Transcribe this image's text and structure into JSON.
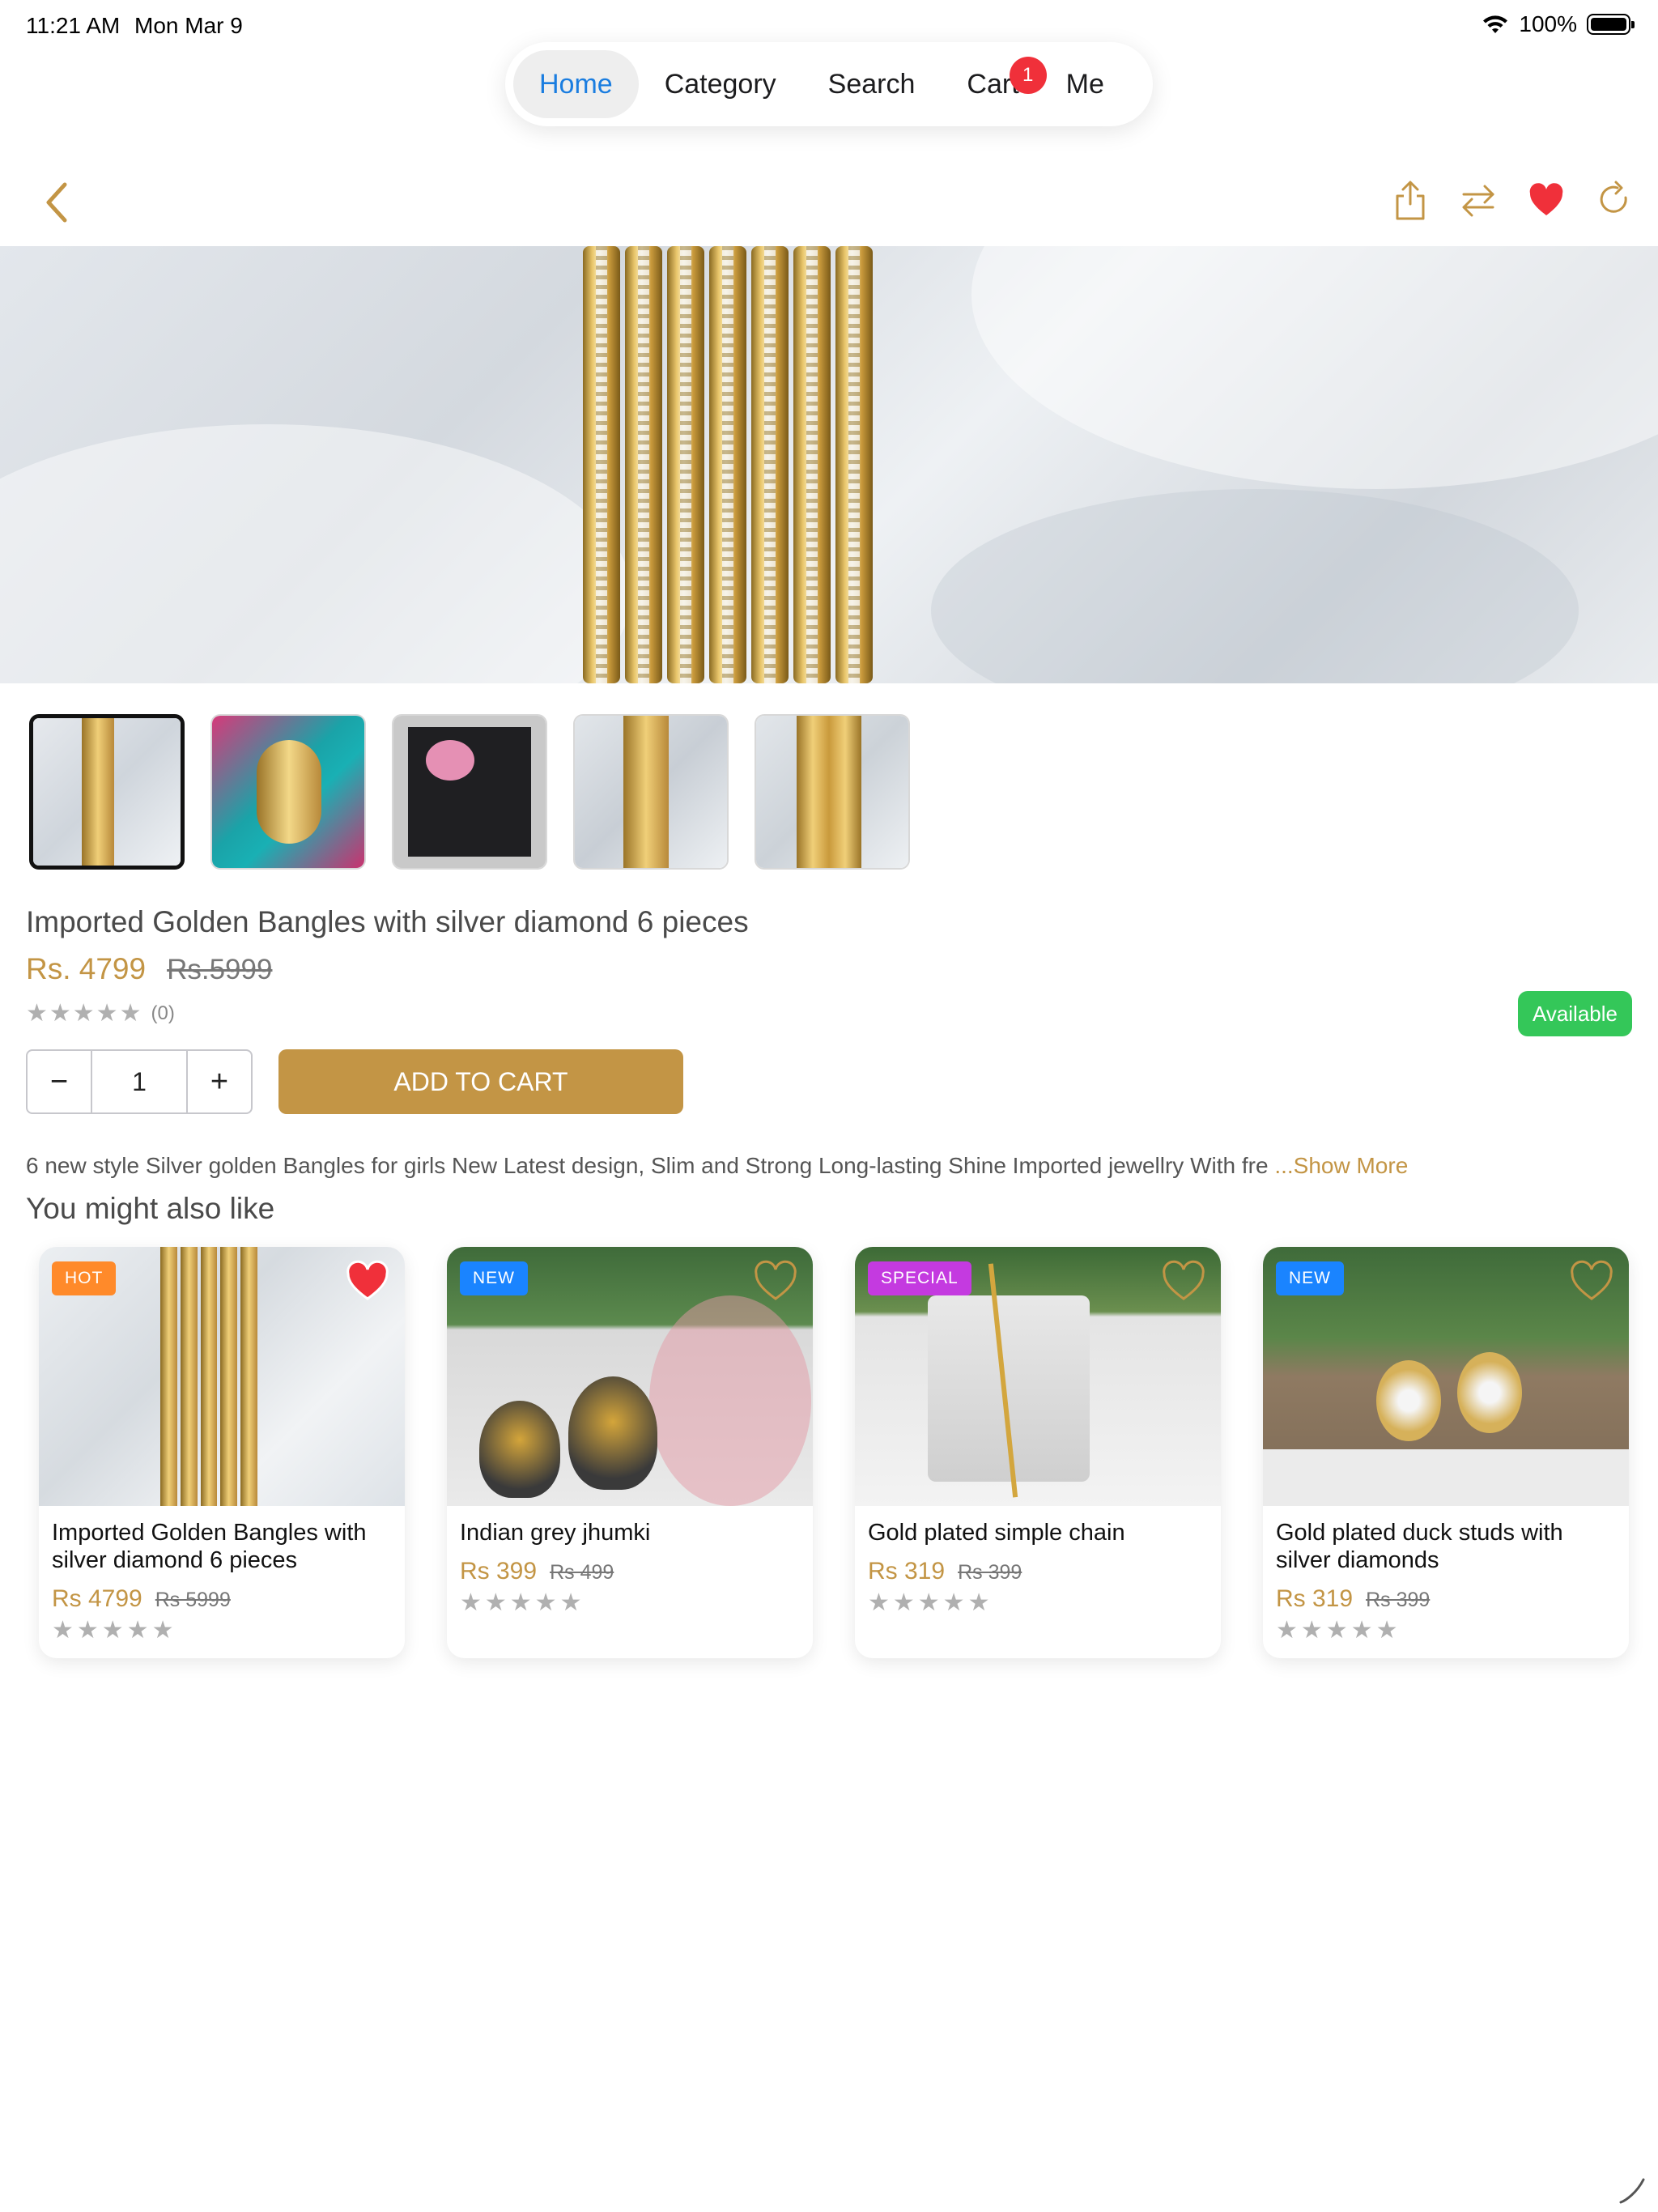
{
  "status_bar": {
    "time": "11:21 AM",
    "date": "Mon Mar 9",
    "battery": "100%"
  },
  "tabbar": {
    "tabs": [
      {
        "label": "Home",
        "active": true
      },
      {
        "label": "Category",
        "active": false
      },
      {
        "label": "Search",
        "active": false
      },
      {
        "label": "Cart",
        "active": false,
        "badge": "1"
      },
      {
        "label": "Me",
        "active": false
      }
    ]
  },
  "nav": {
    "icons": [
      "share-icon",
      "compare-icon",
      "heart-filled-icon",
      "refresh-icon"
    ]
  },
  "colors": {
    "accent": "#c39545",
    "available": "#34c759",
    "badge_hot": "#ff8a2a",
    "badge_new": "#1a84ff",
    "badge_special": "#c43ae0",
    "heart": "#f0303a",
    "active_tab": "#1a7de0"
  },
  "product": {
    "title": "Imported Golden Bangles with silver diamond 6 pieces",
    "price": "Rs. 4799",
    "old_price": "Rs.5999",
    "stars": "★★★★★",
    "rating_count": "(0)",
    "availability": "Available",
    "quantity": "1",
    "add_to_cart": "ADD TO CART",
    "description": "6 new style Silver golden Bangles for girls New Latest design, Slim and Strong Long-lasting Shine Imported jewellry With fre",
    "show_more": "...Show More"
  },
  "qty": {
    "minus": "−",
    "plus": "+"
  },
  "related": {
    "title": "You might also like",
    "items": [
      {
        "badge": "HOT",
        "title": "Imported Golden Bangles with silver diamond 6 pieces",
        "price": "Rs 4799",
        "old_price": "Rs 5999",
        "stars": "★★★★★",
        "favorited": true
      },
      {
        "badge": "NEW",
        "title": "Indian grey jhumki",
        "price": "Rs 399",
        "old_price": "Rs 499",
        "stars": "★★★★★",
        "favorited": false
      },
      {
        "badge": "SPECIAL",
        "title": "Gold plated simple chain",
        "price": "Rs 319",
        "old_price": "Rs 399",
        "stars": "★★★★★",
        "favorited": false
      },
      {
        "badge": "NEW",
        "title": "Gold plated duck studs with silver diamonds",
        "price": "Rs 319",
        "old_price": "Rs 399",
        "stars": "★★★★★",
        "favorited": false
      }
    ]
  }
}
